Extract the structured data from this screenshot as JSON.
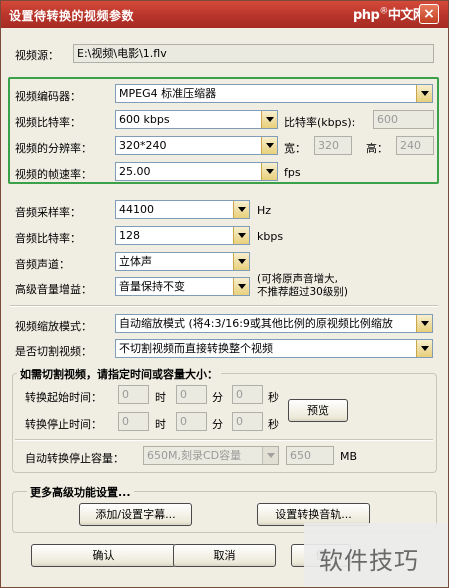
{
  "window": {
    "title": "设置待转换的视频参数",
    "watermark_site": "php",
    "watermark_text": "中文网",
    "close_symbol": "×"
  },
  "source": {
    "label": "视频源：",
    "value": "E:\\视频\\电影\\1.flv"
  },
  "video": {
    "codec_label": "视频编码器：",
    "codec_value": "MPEG4 标准压缩器",
    "bitrate_label": "视频比特率：",
    "bitrate_value": "600 kbps",
    "bitrate_kbps_label": "比特率(kbps):",
    "bitrate_kbps_value": "600",
    "resolution_label": "视频的分辨率：",
    "resolution_value": "320*240",
    "width_label": "宽：",
    "width_value": "320",
    "height_label": "高：",
    "height_value": "240",
    "fps_label": "视频的帧速率：",
    "fps_value": "25.00",
    "fps_unit": "fps"
  },
  "audio": {
    "samplerate_label": "音频采样率：",
    "samplerate_value": "44100",
    "samplerate_unit": "Hz",
    "bitrate_label": "音频比特率：",
    "bitrate_value": "128",
    "bitrate_unit": "kbps",
    "channel_label": "音频声道：",
    "channel_value": "立体声",
    "gain_label": "高级音量增益：",
    "gain_value": "音量保持不变",
    "gain_note_1": "(可将原声音增大,",
    "gain_note_2": "不推荐超过30级别)"
  },
  "scaling": {
    "mode_label": "视频缩放模式：",
    "mode_value": "自动缩放模式 (将4:3/16:9或其他比例的原视频比例缩放",
    "cut_label": "是否切割视频：",
    "cut_value": "不切割视频而直接转换整个视频"
  },
  "cut_group": {
    "title": "如需切割视频，请指定时间或容量大小：",
    "start_label": "转换起始时间：",
    "stop_label": "转换停止时间：",
    "hour_unit": "时",
    "minute_unit": "分",
    "second_unit": "秒",
    "start_h": "0",
    "start_m": "0",
    "start_s": "0",
    "stop_h": "0",
    "stop_m": "0",
    "stop_s": "0",
    "preview_label": "预览",
    "capacity_label": "自动转换停止容量：",
    "capacity_value": "650M,刻录CD容量",
    "capacity_mb_value": "650",
    "capacity_unit": "MB"
  },
  "advanced_group": {
    "title": "更多高级功能设置...",
    "subtitle_button": "添加/设置字幕...",
    "audio_track_button": "设置转换音轨..."
  },
  "footer": {
    "ok_label": "确认",
    "cancel_label": "取消",
    "save_label": "保",
    "overlay_text": "软件技巧"
  }
}
